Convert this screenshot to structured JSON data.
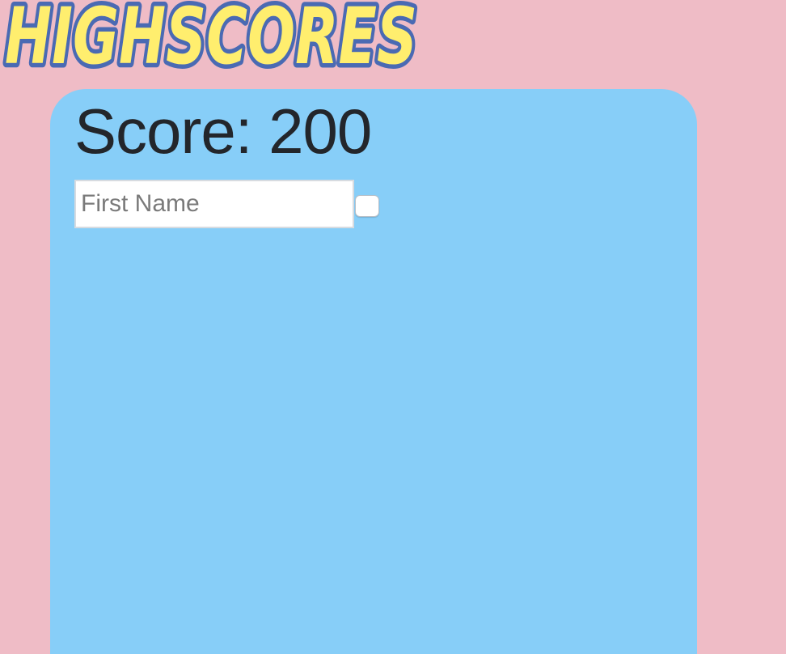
{
  "header": {
    "logo_text": "HIGHSCORES"
  },
  "score": {
    "label": "Score:",
    "value": "200"
  },
  "form": {
    "first_name_placeholder": "First Name",
    "first_name_value": "",
    "submit_label": ""
  },
  "colors": {
    "page_background": "#efbcc6",
    "panel_background": "#87cef8",
    "logo_fill": "#ffee6e",
    "logo_outline": "#4a6ab3"
  }
}
